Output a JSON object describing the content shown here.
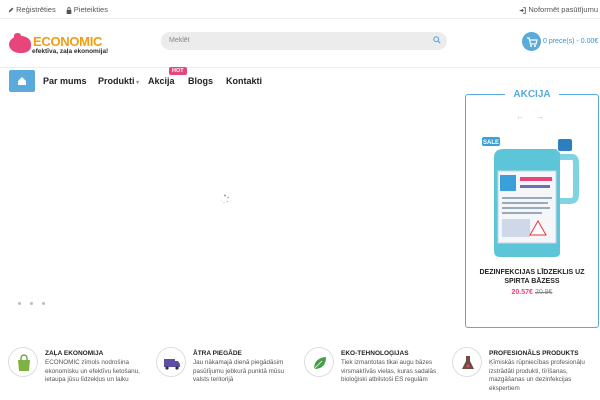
{
  "topbar": {
    "register": "Reģistrēties",
    "login": "Pieteikties",
    "order": "Noformēt pasūtījumu"
  },
  "logo": {
    "brand": "ECONOMIC",
    "tagline": "efektīva, zaļa ekonomija!"
  },
  "search": {
    "placeholder": "Meklēt"
  },
  "cart": {
    "text": "0 prece(s) - 0.00€"
  },
  "nav": {
    "items": [
      "Par mums",
      "Produkti",
      "Akcija",
      "Blogs",
      "Kontakti"
    ],
    "hot_badge": "HOT"
  },
  "akcija": {
    "title": "AKCIJA",
    "product_name": "DEZINFEKCIJAS LĪDZEKLIS UZ SPIRTA BĀZESS",
    "price_new": "20.57€",
    "price_old": "20.9€",
    "sale_label": "SALE"
  },
  "features": [
    {
      "title": "ZAĻA EKONOMIJA",
      "desc": "ECONOMIC zīmols nodrošina ekonomisku un efektīvu lietošanu, ietaupa jūsu līdzekļus un laiku",
      "icon": "eco-bag-icon"
    },
    {
      "title": "ĀTRA PIEGĀDE",
      "desc": "Jau nākamajā dienā piegādāsim pasūtījumu jebkurā punktā mūsu valsts teritorijā",
      "icon": "truck-icon"
    },
    {
      "title": "EKO-TEHNOLOĢIJAS",
      "desc": "Tiek izmantotas tikai augu bāzes virsmaktīvās vielas, kuras sadalās bioloģiski atbilstoši ES regulām",
      "icon": "leaf-icon"
    },
    {
      "title": "PROFESIONĀLS PRODUKTS",
      "desc": "Ķīmiskās rūpniecības profesionāļu izstrādāti produkti, tīrīšanas, mazgāšanas un dezinfekcijas ekspertiem",
      "icon": "flask-icon"
    }
  ],
  "colors": {
    "accent": "#5aaadc",
    "pink": "#e8457a",
    "orange": "#f39c12"
  }
}
